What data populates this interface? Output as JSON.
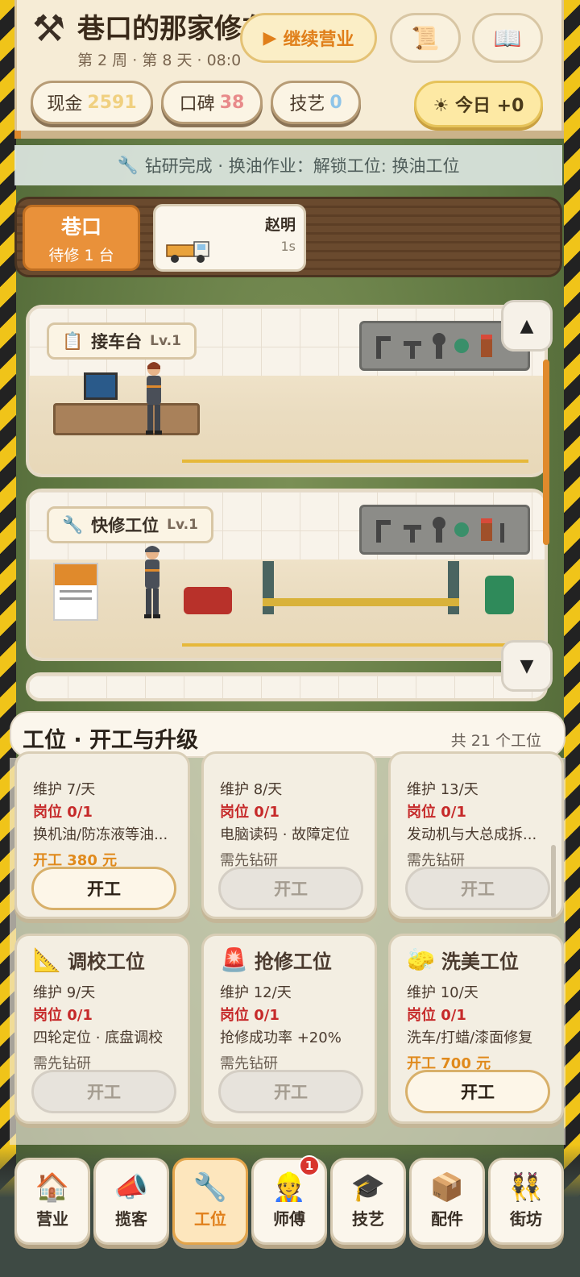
{
  "header": {
    "title": "巷口的那家修车铺",
    "subtitle": "第 2 周 · 第 8 天 · 08:0",
    "continue_label": "继续营业",
    "scroll_icon": "scroll-icon",
    "book_icon": "book-icon",
    "stats": {
      "cash_label": "现金",
      "cash_value": "2591",
      "rep_label": "口碑",
      "rep_value": "38",
      "skill_label": "技艺",
      "skill_value": "0"
    },
    "today_label": "☀ 今日 +0"
  },
  "notice": "钻研完成 · 换油作业：解锁工位: 换油工位",
  "alley": {
    "title": "巷口",
    "pending": "待修 1 台",
    "customer_name": "赵明",
    "customer_time": "1s"
  },
  "stations": [
    {
      "name": "接车台",
      "level": "Lv.1"
    },
    {
      "name": "快修工位",
      "level": "Lv.1"
    }
  ],
  "section": {
    "title": "工位 · 开工与升级",
    "count": "共 21 个工位"
  },
  "cards": [
    {
      "maint": "维护 7/天",
      "post": "岗位 0/1",
      "desc": "换机油/防冻液等油...",
      "status": "开工 380 元",
      "status_type": "cost",
      "button": "开工",
      "enabled": true
    },
    {
      "maint": "维护 8/天",
      "post": "岗位 0/1",
      "desc": "电脑读码 · 故障定位",
      "status": "需先钻研",
      "status_type": "need",
      "button": "开工",
      "enabled": false
    },
    {
      "maint": "维护 13/天",
      "post": "岗位 0/1",
      "desc": "发动机与大总成拆...",
      "status": "需先钻研",
      "status_type": "need",
      "button": "开工",
      "enabled": false
    },
    {
      "name": "调校工位",
      "icon": "📐",
      "maint": "维护 9/天",
      "post": "岗位 0/1",
      "desc": "四轮定位 · 底盘调校",
      "status": "需先钻研",
      "status_type": "need",
      "button": "开工",
      "enabled": false
    },
    {
      "name": "抢修工位",
      "icon": "🚨",
      "maint": "维护 12/天",
      "post": "岗位 0/1",
      "desc": "抢修成功率 +20%",
      "status": "需先钻研",
      "status_type": "need",
      "button": "开工",
      "enabled": false
    },
    {
      "name": "洗美工位",
      "icon": "🧽",
      "maint": "维护 10/天",
      "post": "岗位 0/1",
      "desc": "洗车/打蜡/漆面修复",
      "status": "开工 700 元",
      "status_type": "cost",
      "button": "开工",
      "enabled": true
    }
  ],
  "nav": [
    {
      "label": "营业",
      "icon": "🏠"
    },
    {
      "label": "揽客",
      "icon": "📣"
    },
    {
      "label": "工位",
      "icon": "🔧"
    },
    {
      "label": "师傅",
      "icon": "👷",
      "badge": "1"
    },
    {
      "label": "技艺",
      "icon": "🎓"
    },
    {
      "label": "配件",
      "icon": "📦"
    },
    {
      "label": "街坊",
      "icon": "👯"
    }
  ],
  "colors": {
    "accent": "#e08a2c",
    "cash": "#f0d080",
    "rep": "#e88a8a",
    "skill": "#8ec4e8",
    "warn": "#c62a2a"
  }
}
